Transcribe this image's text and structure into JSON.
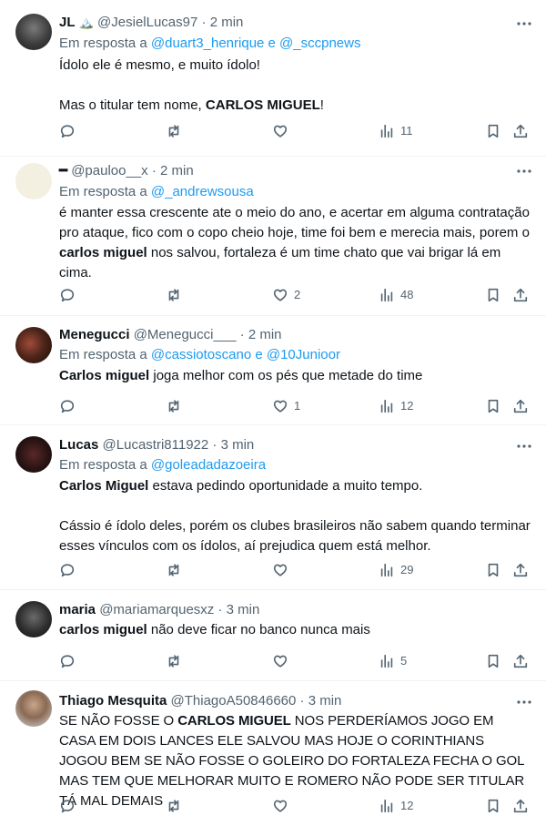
{
  "tweets": [
    {
      "name": "JL",
      "name_extra": "🏔️",
      "handle": "@JesielLucas97",
      "sep": "·",
      "time": "2 min",
      "reply_prefix": "Em resposta a",
      "reply_to": "@duart3_henrique e @_sccpnews",
      "line1": "Ídolo ele é mesmo, e muito ídolo!",
      "line2_pre": "Mas o titular tem nome, ",
      "line2_bold": "CARLOS MIGUEL",
      "line2_post": "!",
      "likes": "",
      "views": "11"
    },
    {
      "name": "━",
      "handle": "@pauloo__x",
      "sep": "·",
      "time": "2 min",
      "reply_prefix": "Em resposta a",
      "reply_to": "@_andrewsousa",
      "text_pre": "é manter essa crescente ate o meio do ano, e acertar em alguma contratação pro ataque, fico com o copo cheio hoje, time foi bem e merecia mais, porem o ",
      "text_bold": "carlos miguel",
      "text_post": " nos salvou, fortaleza é um time chato que vai brigar lá em cima.",
      "likes": "2",
      "views": "48"
    },
    {
      "name": "Menegucci",
      "handle": "@Menegucci___",
      "sep": "·",
      "time": "2 min",
      "reply_prefix": "Em resposta a",
      "reply_to": "@cassiotoscano e @10Junioor",
      "text_bold": "Carlos miguel",
      "text_post": " joga melhor com os pés que metade do time",
      "likes": "1",
      "views": "12"
    },
    {
      "name": "Lucas",
      "handle": "@Lucastri811922",
      "sep": "·",
      "time": "3 min",
      "reply_prefix": "Em resposta a",
      "reply_to": "@goleadadazoeira",
      "text_bold": "Carlos Miguel",
      "text_post": " estava pedindo oportunidade a muito tempo.",
      "line2": "Cássio é ídolo deles, porém os clubes brasileiros não sabem quando terminar esses vínculos com os ídolos, aí prejudica quem está melhor.",
      "likes": "",
      "views": "29"
    },
    {
      "name": "maria",
      "handle": "@mariamarquesxz",
      "sep": "·",
      "time": "3 min",
      "text_bold": "carlos miguel",
      "text_post": " não deve ficar no banco nunca mais",
      "likes": "",
      "views": "5"
    },
    {
      "name": "Thiago Mesquita",
      "handle": "@ThiagoA50846660",
      "sep": "·",
      "time": "3 min",
      "text_pre": "SE NÃO FOSSE O ",
      "text_bold": "CARLOS MIGUEL",
      "text_post": " NOS PERDERÍAMOS JOGO EM CASA EM DOIS LANCES ELE SALVOU MAS HOJE O CORINTHIANS JOGOU BEM SE NÃO FOSSE O GOLEIRO DO FORTALEZA FECHA O GOL MAS TEM QUE MELHORAR MUITO E ROMERO NÃO PODE SER TITULAR TÁ MAL DEMAIS",
      "likes": "",
      "views": "12"
    }
  ],
  "icons": {
    "reply": "reply-icon",
    "retweet": "retweet-icon",
    "like": "heart-icon",
    "views": "views-icon",
    "bookmark": "bookmark-icon",
    "share": "share-icon",
    "more": "more-icon"
  },
  "colors": {
    "link": "#1d9bf0",
    "muted": "#536471",
    "text": "#0f1419",
    "divider": "#eff3f4"
  }
}
